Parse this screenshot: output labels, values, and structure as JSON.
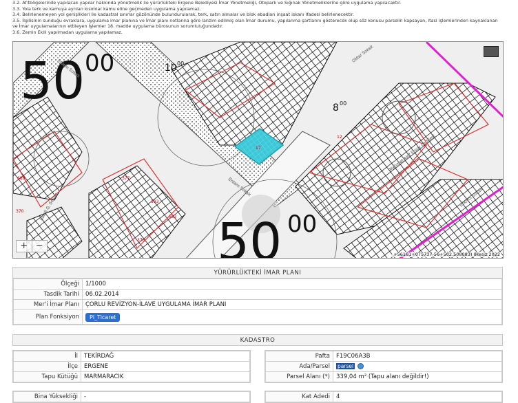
{
  "notes": [
    "3.2. Af:tbögelerinde yapılacak yapılar hakkında yönetmelik ile yürürlükteki Ergene Belediyesi İmar Yönetmeliği, Otopark ve Sığınak Yönetmeliklerine göre uygulama yapılacaktır.",
    "3.3. Yola terk ve kamuya ayrılan kısımlar kamu eline geçmeden uygulama yapılamaz.",
    "3.4. Belirlenemeyen yol genişlikleri ile kadastral sınırlar gözönünde bulundurularak, terk, satın almalar ve blok ebadları inşaat iskanı ifadesi belirlenecektir.",
    "3.5. İlgilisinin sunduğu evraklara, uygulama imar planına ve İmar planı notlarına göre lanzim edilmiş olan İmar durumu, yapılanma şartlarını gösterecek olup söz konusu parselin kapsayan, Itasi işlemlerinden kaynaklanan",
    "ve İmar uygulamalarının ettileyen İşlemler 18. madde uygulama bürosunun sorumluluğundadır.",
    "3.6. Zemin Ekili yapılmadan uygulama yapılamaz."
  ],
  "map": {
    "big_labels": [
      "50",
      "00",
      "50",
      "00"
    ],
    "small_labels": [
      "10",
      "00",
      "8",
      "00"
    ],
    "street_labels": [
      "Erdem Sokak",
      "Oktar Sokak",
      "Mehmet Akif Ersoy Caddesi",
      "Eskiyol Sokak",
      "Erdem Sokak",
      "Kaleli G. Sokak"
    ],
    "parcel_labels": [
      "377",
      "593",
      "592",
      "376",
      "17",
      "370",
      "689",
      "12"
    ],
    "zoom_in": "+",
    "zoom_out": "−",
    "coordinates": "+56161+075737-56+502.508083) Ilkesiz 2022",
    "colors": {
      "highlight": "#3cc8d8",
      "boundary_red": "#e03030",
      "boundary_magenta": "#e020d0"
    }
  },
  "imar": {
    "title": "YÜRÜRLÜKTEKİ İMAR PLANI",
    "rows": [
      {
        "label": "Ölçeği",
        "value": "1/1000"
      },
      {
        "label": "Tasdik Tarihi",
        "value": "06.02.2014"
      },
      {
        "label": "Mer'i İmar Planı",
        "value": "ÇORLU REVİZYON-İLAVE UYGULAMA İMAR PLANI"
      },
      {
        "label": "Plan Fonksiyon",
        "value": "Pl_Ticaret"
      }
    ]
  },
  "kadastro": {
    "title": "KADASTRO",
    "left": [
      {
        "label": "İl",
        "value": "TEKİRDAĞ"
      },
      {
        "label": "İlçe",
        "value": "ERGENE"
      },
      {
        "label": "Tapu Kütüğü",
        "value": "MARMARACIK"
      }
    ],
    "right": [
      {
        "label": "Pafta",
        "value": "F19C06A3B"
      },
      {
        "label": "Ada/Parsel",
        "value": "parsel"
      },
      {
        "label": "Parsel Alanı (*)",
        "value": "339,04 m² (Tapu alanı değildir!)"
      }
    ]
  },
  "bottom": {
    "left": {
      "label": "Bina Yüksekliği",
      "value": "-"
    },
    "right": {
      "label": "Kat Adedi",
      "value": "4"
    }
  }
}
